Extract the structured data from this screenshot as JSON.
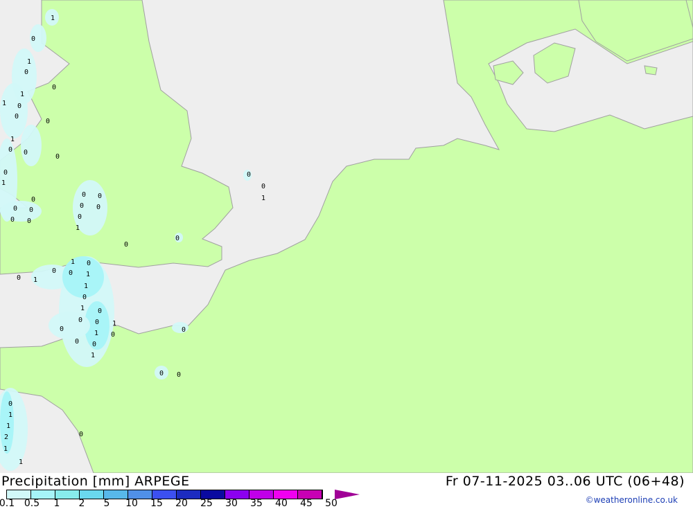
{
  "map": {
    "colors": {
      "land": "#ccffaa",
      "sea": "#eeeeee",
      "border": "#a0a0a0",
      "precip_light": "#d2f8f8",
      "precip_mid": "#a6f4f8",
      "precip_high": "#88ecec"
    },
    "labels": [
      "1",
      "0",
      "1",
      "0",
      "0",
      "1",
      "1",
      "0",
      "0",
      "0",
      "1",
      "0",
      "0",
      "0",
      "0",
      "1",
      "0",
      "0",
      "0",
      "0",
      "0",
      "0",
      "0",
      "0",
      "0",
      "0",
      "0",
      "1",
      "0",
      "0",
      "1",
      "0",
      "1",
      "0",
      "0",
      "1",
      "1",
      "0",
      "0",
      "1",
      "0",
      "1",
      "0",
      "0",
      "0",
      "1",
      "0",
      "1",
      "0",
      "0",
      "0",
      "1",
      "0",
      "0",
      "0",
      "0",
      "1",
      "1",
      "2",
      "1",
      "0",
      "1"
    ]
  },
  "footer": {
    "title": "Precipitation [mm] ARPEGE",
    "time": "Fr 07-11-2025 03..06 UTC (06+48)",
    "credit": "©weatheronline.co.uk",
    "legend": {
      "ticks": [
        "0.1",
        "0.5",
        "1",
        "2",
        "5",
        "10",
        "15",
        "20",
        "25",
        "30",
        "35",
        "40",
        "45",
        "50"
      ],
      "colors": [
        "#d2f8f8",
        "#a6f4f8",
        "#88ecec",
        "#6ad8ee",
        "#58b8ea",
        "#5090e8",
        "#3c50f0",
        "#1c2cc0",
        "#0a0aa0",
        "#8c00f0",
        "#c000e8",
        "#f000f0",
        "#c800b4"
      ],
      "overflow_color": "#a00096"
    }
  }
}
